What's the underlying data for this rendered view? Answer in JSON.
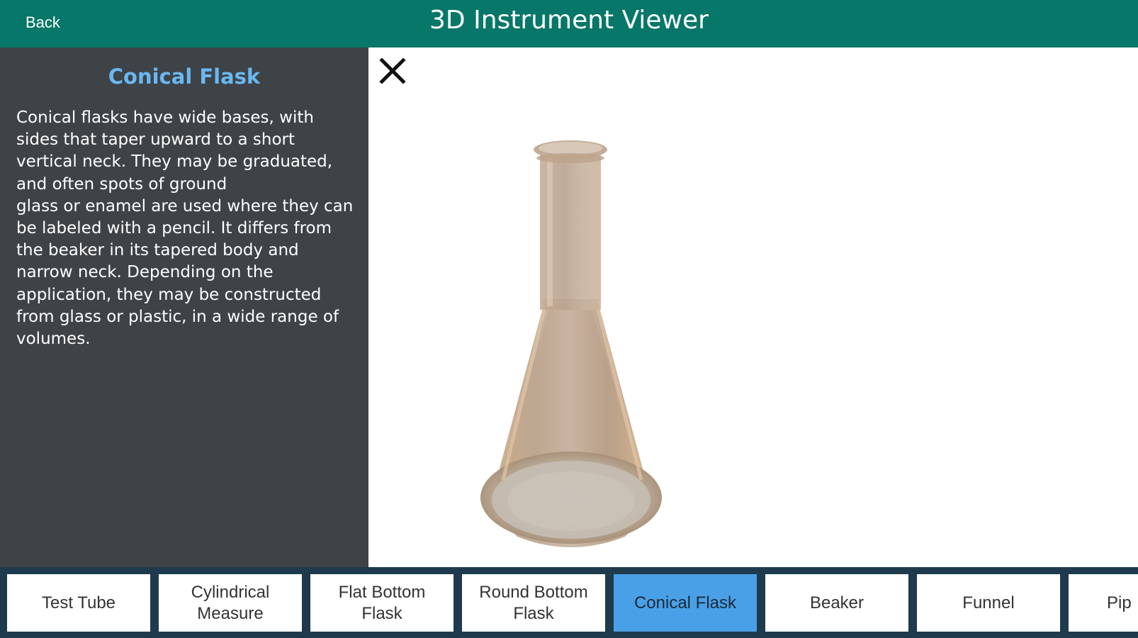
{
  "header": {
    "back_label": "Back",
    "title": "3D Instrument Viewer"
  },
  "info": {
    "title": "Conical Flask",
    "description": "Conical flasks have wide bases, with\nsides that taper upward to a short\nvertical neck. They may be graduated,\nand often spots of ground\nglass or enamel are used where they can\nbe labeled with a pencil. It differs from\nthe beaker in its tapered body and\nnarrow neck. Depending on the\napplication, they may be constructed\nfrom glass or plastic, in a wide range of\nvolumes."
  },
  "viewer": {
    "close_icon": "close-icon",
    "model": "conical-flask-3d-model"
  },
  "tabs": [
    {
      "label": "Test Tube"
    },
    {
      "label": "Cylindrical\nMeasure"
    },
    {
      "label": "Flat Bottom\nFlask"
    },
    {
      "label": "Round Bottom\nFlask"
    },
    {
      "label": "Conical Flask"
    },
    {
      "label": "Beaker"
    },
    {
      "label": "Funnel"
    },
    {
      "label": "Pip"
    }
  ],
  "active_tab": "Conical Flask",
  "colors": {
    "header": "#067768",
    "panel": "#3e4347",
    "title_accent": "#6ab8f0",
    "bottom_bar": "#1f3a4d",
    "active_tab": "#4aa0e6"
  }
}
